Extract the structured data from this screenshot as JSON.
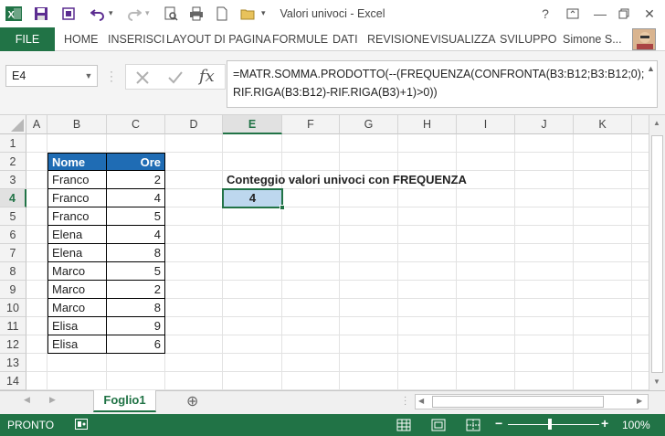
{
  "window": {
    "title": "Valori univoci - Excel",
    "help": "?",
    "minimize": "—",
    "close": "✕"
  },
  "ribbon": {
    "file": "FILE",
    "tabs": [
      "HOME",
      "INSERISCI",
      "LAYOUT DI PAGINA",
      "FORMULE",
      "DATI",
      "REVISIONE",
      "VISUALIZZA",
      "SVILUPPO"
    ],
    "user": "Simone S..."
  },
  "formula_bar": {
    "name_box": "E4",
    "fx": "fx",
    "formula": "=MATR.SOMMA.PRODOTTO(--(FREQUENZA(CONFRONTA(B3:B12;B3:B12;0);RIF.RIGA(B3:B12)-RIF.RIGA(B3)+1)>0))"
  },
  "sheet": {
    "columns": [
      "A",
      "B",
      "C",
      "D",
      "E",
      "F",
      "G",
      "H",
      "I",
      "J",
      "K"
    ],
    "rows": [
      "1",
      "2",
      "3",
      "4",
      "5",
      "6",
      "7",
      "8",
      "9",
      "10",
      "11",
      "12",
      "13",
      "14"
    ],
    "selected_cell": "E4",
    "table": {
      "headers": [
        "Nome",
        "Ore"
      ],
      "header_color": "#1f6cb4",
      "rows": [
        [
          "Franco",
          "2"
        ],
        [
          "Franco",
          "4"
        ],
        [
          "Franco",
          "5"
        ],
        [
          "Elena",
          "4"
        ],
        [
          "Elena",
          "8"
        ],
        [
          "Marco",
          "5"
        ],
        [
          "Marco",
          "2"
        ],
        [
          "Marco",
          "8"
        ],
        [
          "Elisa",
          "9"
        ],
        [
          "Elisa",
          "6"
        ]
      ]
    },
    "label_e3": "Conteggio valori univoci con FREQUENZA",
    "result_e4": "4",
    "result_fill": "#bdd7ee"
  },
  "sheet_tabs": {
    "active": "Foglio1",
    "add": "⊕"
  },
  "status_bar": {
    "status": "PRONTO",
    "zoom": "100%",
    "zoom_level_percent": 100,
    "accent": "#217346"
  }
}
